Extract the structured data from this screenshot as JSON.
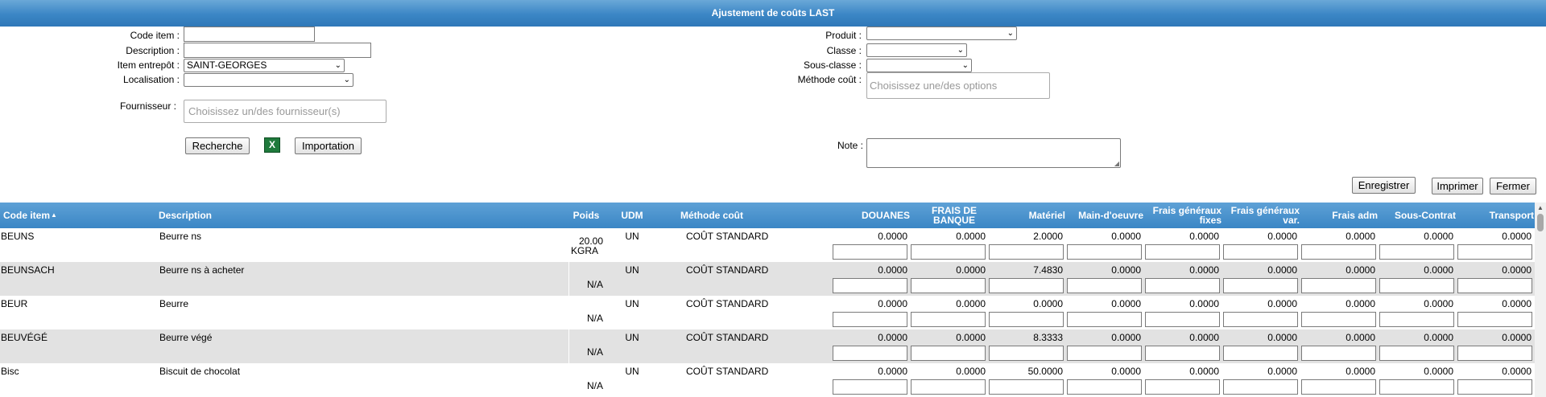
{
  "title": "Ajustement de coûts LAST",
  "form": {
    "code_item_label": "Code item :",
    "code_item_value": "",
    "description_label": "Description :",
    "description_value": "",
    "item_entrepot_label": "Item entrepôt :",
    "item_entrepot_value": "SAINT-GEORGES",
    "localisation_label": "Localisation :",
    "localisation_value": "",
    "fournisseur_label": "Fournisseur :",
    "fournisseur_placeholder": "Choisissez un/des fournisseur(s)",
    "produit_label": "Produit :",
    "produit_value": "",
    "classe_label": "Classe :",
    "classe_value": "",
    "sous_classe_label": "Sous-classe :",
    "sous_classe_value": "",
    "methode_label": "Méthode coût :",
    "methode_placeholder": "Choisissez une/des options",
    "note_label": "Note :"
  },
  "buttons": {
    "recherche": "Recherche",
    "excel_icon": "excel-icon",
    "importation": "Importation",
    "enregistrer": "Enregistrer",
    "imprimer": "Imprimer",
    "fermer": "Fermer"
  },
  "table": {
    "headers": {
      "code": "Code item",
      "sort_arrow": "▲",
      "description": "Description",
      "poids": "Poids",
      "udm": "UDM",
      "methode": "Méthode coût",
      "douanes": "DOUANES",
      "frais_banque": "FRAIS DE BANQUE",
      "materiel": "Matériel",
      "main_oeuvre": "Main-d'oeuvre",
      "fgf": "Frais généraux fixes",
      "fgv": "Frais généraux var.",
      "frais_adm": "Frais adm",
      "sous_contrat": "Sous-Contrat",
      "transport": "Transport"
    },
    "rows": [
      {
        "code": "BEUNS",
        "description": "Beurre ns",
        "poids": "20.00",
        "poids_unit": "KGRA",
        "udm": "UN",
        "methode": "COÛT STANDARD",
        "values": [
          "0.0000",
          "0.0000",
          "2.0000",
          "0.0000",
          "0.0000",
          "0.0000",
          "0.0000",
          "0.0000",
          "0.0000"
        ]
      },
      {
        "code": "BEUNSACH",
        "description": "Beurre ns à acheter",
        "poids": "",
        "poids_unit": "N/A",
        "udm": "UN",
        "methode": "COÛT STANDARD",
        "values": [
          "0.0000",
          "0.0000",
          "7.4830",
          "0.0000",
          "0.0000",
          "0.0000",
          "0.0000",
          "0.0000",
          "0.0000"
        ]
      },
      {
        "code": "BEUR",
        "description": "Beurre",
        "poids": "",
        "poids_unit": "N/A",
        "udm": "UN",
        "methode": "COÛT STANDARD",
        "values": [
          "0.0000",
          "0.0000",
          "0.0000",
          "0.0000",
          "0.0000",
          "0.0000",
          "0.0000",
          "0.0000",
          "0.0000"
        ]
      },
      {
        "code": "BEUVÉGÉ",
        "description": "Beurre végé",
        "poids": "",
        "poids_unit": "N/A",
        "udm": "UN",
        "methode": "COÛT STANDARD",
        "values": [
          "0.0000",
          "0.0000",
          "8.3333",
          "0.0000",
          "0.0000",
          "0.0000",
          "0.0000",
          "0.0000",
          "0.0000"
        ]
      },
      {
        "code": "Bisc",
        "description": "Biscuit de chocolat",
        "poids": "",
        "poids_unit": "N/A",
        "udm": "UN",
        "methode": "COÛT STANDARD",
        "values": [
          "0.0000",
          "0.0000",
          "50.0000",
          "0.0000",
          "0.0000",
          "0.0000",
          "0.0000",
          "0.0000",
          "0.0000"
        ]
      }
    ]
  }
}
